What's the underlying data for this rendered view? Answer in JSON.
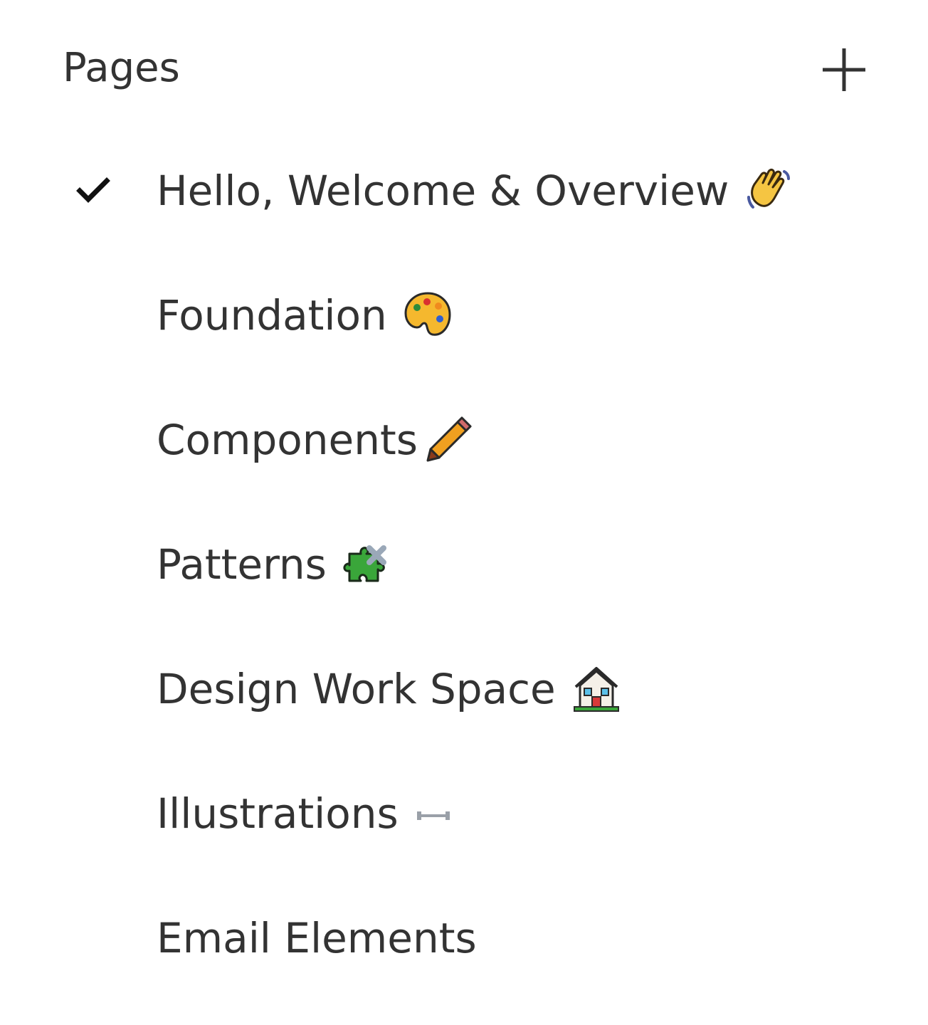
{
  "panel": {
    "title": "Pages",
    "add_icon": "plus-icon"
  },
  "pages": [
    {
      "label": "Hello, Welcome & Overview",
      "icon": "waving-hand-icon",
      "selected": true
    },
    {
      "label": "Foundation",
      "icon": "palette-icon",
      "selected": false
    },
    {
      "label": "Components",
      "icon": "pencil-icon",
      "selected": false
    },
    {
      "label": "Patterns",
      "icon": "puzzle-piece-icon",
      "selected": false
    },
    {
      "label": "Design Work Space",
      "icon": "house-icon",
      "selected": false
    },
    {
      "label": "Illustrations",
      "icon": "arrow-right-icon",
      "selected": false
    },
    {
      "label": "Email Elements",
      "icon": "",
      "selected": false
    }
  ],
  "colors": {
    "text": "#333333",
    "icon": "#333333"
  }
}
